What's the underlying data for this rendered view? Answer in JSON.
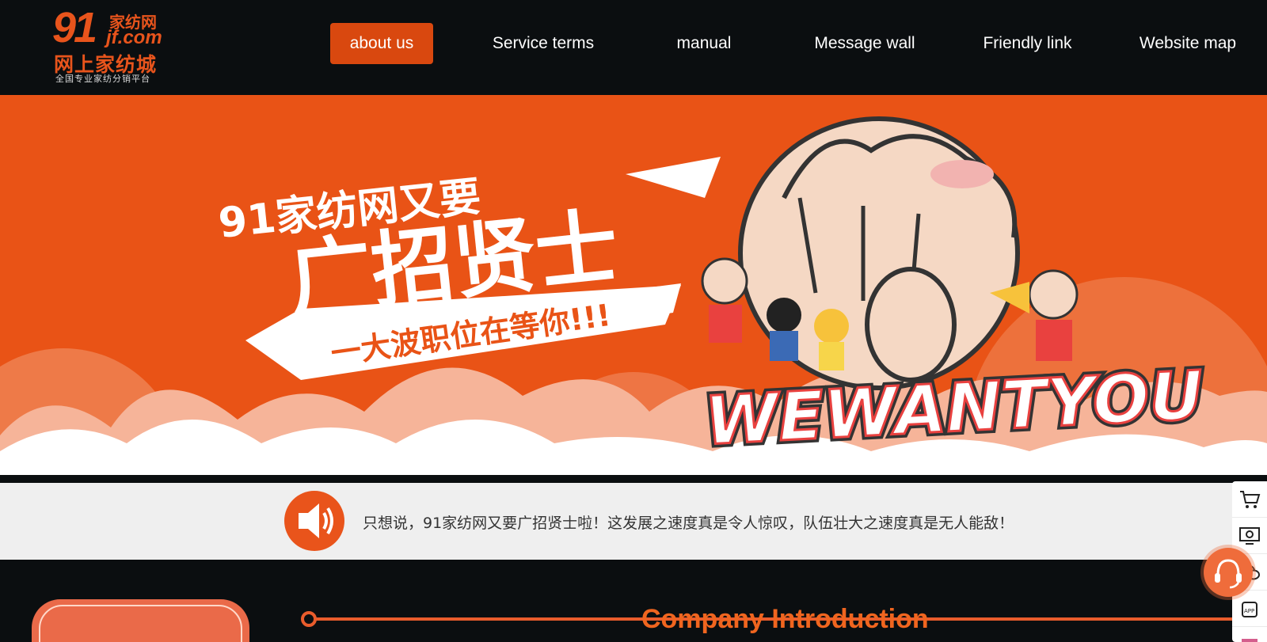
{
  "logo": {
    "number": "91",
    "brand": "家纺网",
    "domain": "jf.com",
    "mall": "网上家纺城",
    "tagline": "全国专业家纺分销平台"
  },
  "nav": {
    "items": [
      {
        "label": "about us",
        "active": true
      },
      {
        "label": "Service terms"
      },
      {
        "label": "manual"
      },
      {
        "label": "Message wall"
      },
      {
        "label": "Friendly link"
      },
      {
        "label": "Website map"
      }
    ]
  },
  "banner": {
    "line1": "91家纺网又要",
    "line2": "广招贤士",
    "line3": "一大波职位在等你!!!",
    "slogan": "WEWANTYOU",
    "colors": {
      "bg": "#e95316",
      "cloud": "#f6b499",
      "white": "#ffffff"
    }
  },
  "notice": {
    "icon": "speaker-icon",
    "text": "只想说，91家纺网又要广招贤士啦！这发展之速度真是令人惊叹，队伍壮大之速度真是无人能敌！"
  },
  "section": {
    "title": "Company Introduction"
  },
  "floatbar": {
    "items": [
      "cart-icon",
      "monitor-icon",
      "wechat-icon",
      "app-icon",
      "qrcode-icon"
    ]
  },
  "colors": {
    "accent": "#e8541c",
    "dark": "#0b0e10"
  }
}
